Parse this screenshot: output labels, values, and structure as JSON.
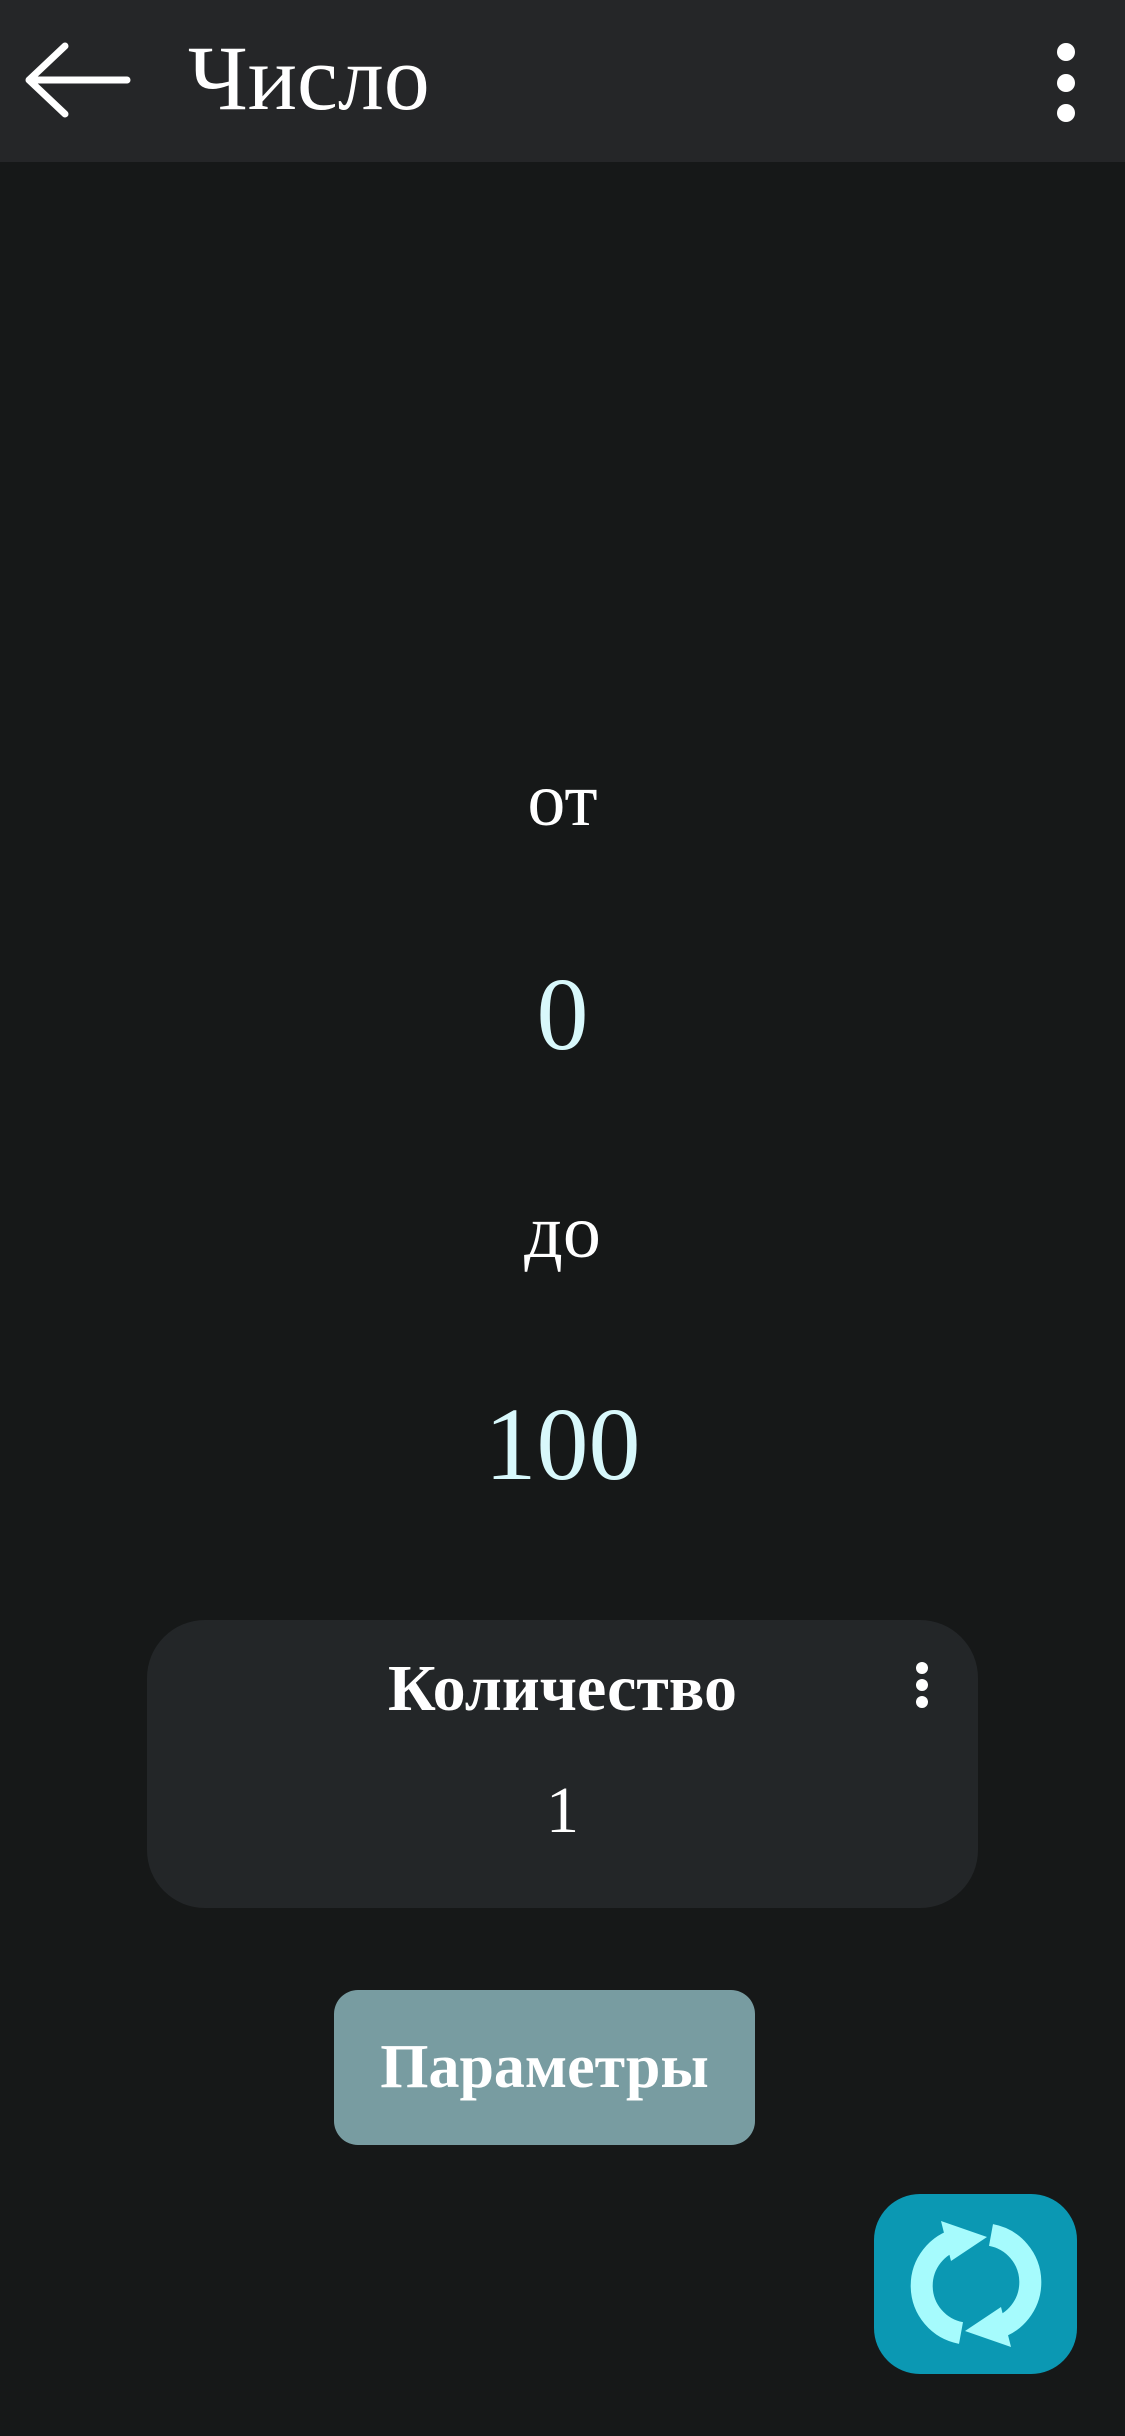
{
  "appbar": {
    "title": "Число",
    "back_icon": "arrow-left-icon",
    "menu_icon": "more-vertical-icon"
  },
  "range": {
    "from_label": "от",
    "from_value": "0",
    "to_label": "до",
    "to_value": "100"
  },
  "count_card": {
    "label": "Количество",
    "value": "1",
    "menu_icon": "more-vertical-icon"
  },
  "params_button": {
    "label": "Параметры"
  },
  "fab": {
    "icon": "refresh-icon"
  },
  "colors": {
    "background": "#161818",
    "appbar": "#252628",
    "value_text": "#d8f8fb",
    "card": "#232628",
    "params_button": "#789ca1",
    "fab": "#0b98b3",
    "fab_icon": "#a6fbfd"
  }
}
